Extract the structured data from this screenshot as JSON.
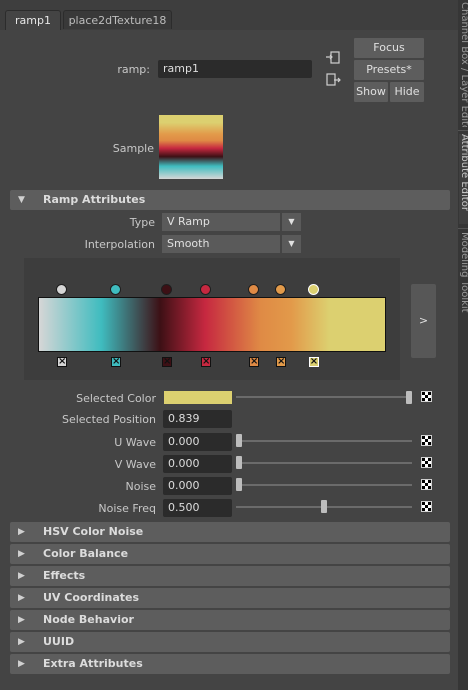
{
  "tabs": [
    "ramp1",
    "place2dTexture18"
  ],
  "side_tabs": [
    "Channel Box / Layer Editor",
    "Attribute Editor",
    "Modeling Toolkit"
  ],
  "header": {
    "ramp_label": "ramp:",
    "ramp_value": "ramp1",
    "focus": "Focus",
    "presets": "Presets*",
    "show": "Show",
    "hide": "Hide",
    "sample_label": "Sample"
  },
  "ramp_attributes": {
    "title": "Ramp Attributes",
    "type_label": "Type",
    "type_value": "V Ramp",
    "interp_label": "Interpolation",
    "interp_value": "Smooth",
    "expand_label": ">",
    "stops": [
      {
        "color": "#d6d6d6",
        "pos": 0.0
      },
      {
        "color": "#3fbcbf",
        "pos": 0.18
      },
      {
        "color": "#3d1015",
        "pos": 0.35
      },
      {
        "color": "#c62840",
        "pos": 0.48
      },
      {
        "color": "#df8a45",
        "pos": 0.64
      },
      {
        "color": "#e29a4a",
        "pos": 0.73
      },
      {
        "color": "#dcd070",
        "pos": 0.839
      }
    ],
    "selected_color_label": "Selected Color",
    "selected_color": "#dcd070",
    "selected_position_label": "Selected Position",
    "selected_position": "0.839",
    "u_wave_label": "U Wave",
    "u_wave": "0.000",
    "v_wave_label": "V Wave",
    "v_wave": "0.000",
    "noise_label": "Noise",
    "noise": "0.000",
    "noise_freq_label": "Noise Freq",
    "noise_freq": "0.500"
  },
  "sections": [
    "HSV Color Noise",
    "Color Balance",
    "Effects",
    "UV Coordinates",
    "Node Behavior",
    "UUID",
    "Extra Attributes"
  ]
}
